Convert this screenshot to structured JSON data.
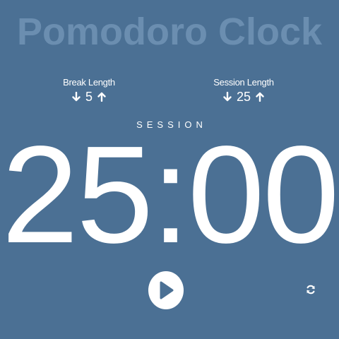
{
  "app": {
    "title": "Pomodoro Clock"
  },
  "break": {
    "label": "Break Length",
    "value": "5",
    "decrement_icon": "arrow-down-icon",
    "increment_icon": "arrow-up-icon"
  },
  "session": {
    "label": "Session Length",
    "value": "25",
    "decrement_icon": "arrow-down-icon",
    "increment_icon": "arrow-up-icon"
  },
  "timer": {
    "mode": "SESSION",
    "time": "25:00"
  },
  "controls": {
    "play_icon": "play-icon",
    "reset_icon": "refresh-icon"
  },
  "colors": {
    "background": "#4b7094",
    "title": "#6b8eb0",
    "foreground": "#ffffff",
    "play_triangle": "#4b7094"
  }
}
